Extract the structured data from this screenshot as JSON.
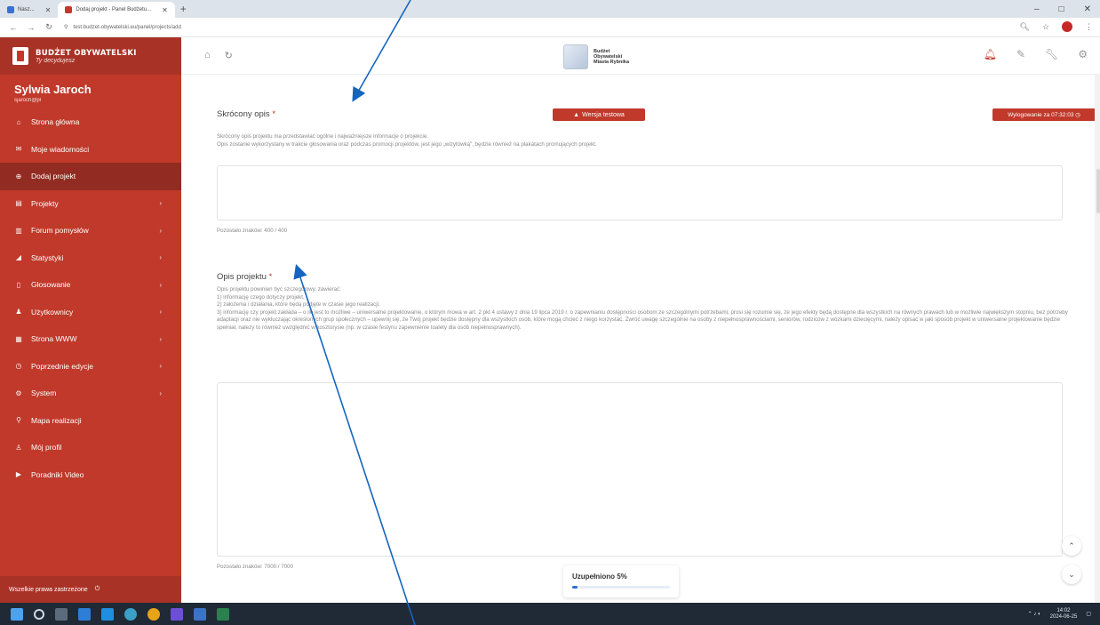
{
  "browser": {
    "tabs": [
      {
        "label": "Nasz...",
        "active": false
      },
      {
        "label": "Dodaj projekt - Panel Budżetu...",
        "active": true
      }
    ],
    "new_tab": "+",
    "url": "test.budzet-obywatelski.eu/panel/projects/add",
    "window_controls": [
      "–",
      "□",
      "✕"
    ]
  },
  "brand": {
    "title": "BUDŻET OBYWATELSKI",
    "subtitle": "Ty decydujesz"
  },
  "user": {
    "name": "Sylwia Jaroch",
    "email": "sjaroch@pl"
  },
  "menu": [
    {
      "label": "Strona główna",
      "icon": "home-icon",
      "glyph": "⌂",
      "chevron": false,
      "active": false
    },
    {
      "label": "Moje wiadomości",
      "icon": "mail-icon",
      "glyph": "✉",
      "chevron": false,
      "active": false
    },
    {
      "label": "Dodaj projekt",
      "icon": "plus-circle-icon",
      "glyph": "⊕",
      "chevron": false,
      "active": true
    },
    {
      "label": "Projekty",
      "icon": "document-icon",
      "glyph": "▤",
      "chevron": true,
      "active": false
    },
    {
      "label": "Forum pomysłów",
      "icon": "forum-icon",
      "glyph": "▥",
      "chevron": true,
      "active": false
    },
    {
      "label": "Statystyki",
      "icon": "chart-icon",
      "glyph": "◢",
      "chevron": true,
      "active": false
    },
    {
      "label": "Głosowanie",
      "icon": "ballot-icon",
      "glyph": "▯",
      "chevron": true,
      "active": false
    },
    {
      "label": "Użytkownicy",
      "icon": "users-icon",
      "glyph": "♟",
      "chevron": true,
      "active": false
    },
    {
      "label": "Strona WWW",
      "icon": "web-icon",
      "glyph": "▦",
      "chevron": true,
      "active": false
    },
    {
      "label": "Poprzednie edycje",
      "icon": "history-icon",
      "glyph": "◷",
      "chevron": true,
      "active": false
    },
    {
      "label": "System",
      "icon": "gear-icon",
      "glyph": "⚙",
      "chevron": true,
      "active": false
    },
    {
      "label": "Mapa realizacji",
      "icon": "map-pin-icon",
      "glyph": "⚲",
      "chevron": false,
      "active": false
    },
    {
      "label": "Mój profil",
      "icon": "user-icon",
      "glyph": "♙",
      "chevron": false,
      "active": false
    },
    {
      "label": "Poradniki Video",
      "icon": "video-icon",
      "glyph": "▶",
      "chevron": false,
      "active": false
    }
  ],
  "footer": {
    "text": "Wszelkie prawa zastrzeżone",
    "icon": "power-icon"
  },
  "appbar": {
    "logo_lines": [
      "Budżet",
      "Obywatelski",
      "Miasta Rybnika"
    ]
  },
  "badges": {
    "test_version": "Wersja testowa",
    "logout_timer": "Wylogowanie za 07:32:03"
  },
  "short_desc": {
    "title": "Skrócony opis",
    "required_mark": "*",
    "help_lines": [
      "Skrócony opis projektu ma przedstawiać ogólne i najważniejsze informacje o projekcie.",
      "Opis zostanie wykorzystany w trakcie głosowania oraz podczas promocji projektów, jest jego „wizytówką\", będzie również na plakatach promujących projekt."
    ],
    "counter": "Pozostało znaków: 400 / 400"
  },
  "full_desc": {
    "title": "Opis projektu",
    "required_mark": "*",
    "help_lines": [
      "Opis projektu powinien być szczegółowy, zawierać:",
      "1) informację czego dotyczy projekt,",
      "2) założenia i działania, które będą podjęte w czasie jego realizacji,",
      "3) informację czy projekt zakłada – o ile jest to możliwe – uniwersalne projektowanie, o którym mowa w art. 2 pkt 4 ustawy z dnia 19 lipca 2019 r. o zapewnianiu dostępności osobom ze szczególnymi potrzebami, prosi się rozumie się, że jego efekty będą dostępne dla wszystkich na równych prawach lub w możliwie największym stopniu, bez potrzeby adaptacji oraz nie wykluczając określonych grup społecznych – upewnij się, że Twój projekt będzie dostępny dla wszystkich osób, które mogą chcieć z niego korzystać. Zwróć uwagę szczególnie na osoby z niepełnosprawnościami, seniorów, rodziców z wózkami dziecięcymi, należy opisać w jaki sposób projekt w uniwersalne projektowanie będzie spełniał, należy to również uwzględnić w kosztorysie (np. w czasie festynu zapewnienie toalety dla osób niepełnosprawnych)."
    ],
    "counter": "Pozostało znaków: 7000 / 7000"
  },
  "progress": {
    "label": "Uzupełniono 5%",
    "fraction": 0.05
  },
  "colors": {
    "brand": "#c0392b",
    "brand_dark": "#922b21",
    "accent": "#2a6fd6",
    "arrow": "#1565c0"
  },
  "taskbar": {
    "time": "14:02",
    "date": "2024-06-25"
  }
}
